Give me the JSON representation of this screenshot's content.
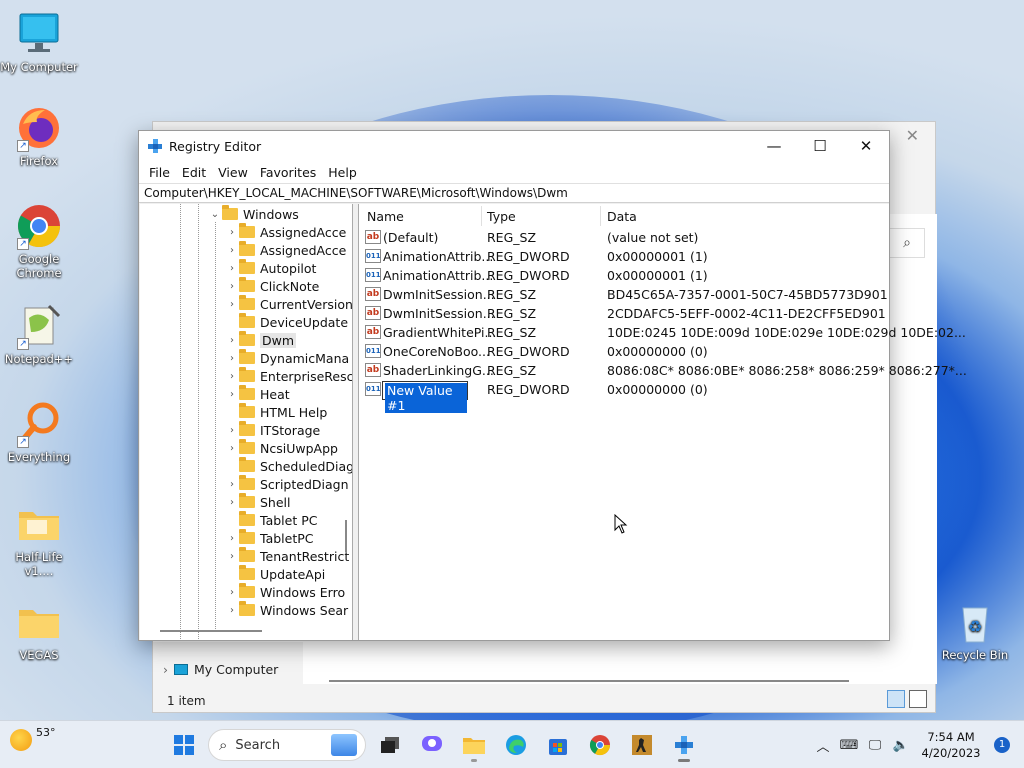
{
  "desktop": {
    "icons": [
      {
        "label": "My Computer"
      },
      {
        "label": "Firefox"
      },
      {
        "label": "Google Chrome"
      },
      {
        "label": "Notepad++"
      },
      {
        "label": "Everything"
      },
      {
        "label": "Half-Life v1...."
      },
      {
        "label": "VEGAS"
      },
      {
        "label": "Recycle Bin"
      }
    ]
  },
  "explorer": {
    "nav_item": "My Computer",
    "status": "1 item"
  },
  "regedit": {
    "title": "Registry Editor",
    "menu": [
      "File",
      "Edit",
      "View",
      "Favorites",
      "Help"
    ],
    "address": "Computer\\HKEY_LOCAL_MACHINE\\SOFTWARE\\Microsoft\\Windows\\Dwm",
    "tree": [
      {
        "label": "Windows",
        "expanded": true
      },
      {
        "label": "AssignedAcce"
      },
      {
        "label": "AssignedAcce"
      },
      {
        "label": "Autopilot"
      },
      {
        "label": "ClickNote"
      },
      {
        "label": "CurrentVersion"
      },
      {
        "label": "DeviceUpdate"
      },
      {
        "label": "Dwm",
        "selected": true
      },
      {
        "label": "DynamicMana"
      },
      {
        "label": "EnterpriseResc"
      },
      {
        "label": "Heat"
      },
      {
        "label": "HTML Help"
      },
      {
        "label": "ITStorage"
      },
      {
        "label": "NcsiUwpApp"
      },
      {
        "label": "ScheduledDiag"
      },
      {
        "label": "ScriptedDiagn"
      },
      {
        "label": "Shell"
      },
      {
        "label": "Tablet PC"
      },
      {
        "label": "TabletPC"
      },
      {
        "label": "TenantRestrict"
      },
      {
        "label": "UpdateApi"
      },
      {
        "label": "Windows Erro"
      },
      {
        "label": "Windows Sear"
      }
    ],
    "columns": {
      "name": "Name",
      "type": "Type",
      "data": "Data"
    },
    "values": [
      {
        "name": "(Default)",
        "type": "REG_SZ",
        "data": "(value not set)",
        "kind": "sz"
      },
      {
        "name": "AnimationAttrib...",
        "type": "REG_DWORD",
        "data": "0x00000001 (1)",
        "kind": "dw"
      },
      {
        "name": "AnimationAttrib...",
        "type": "REG_DWORD",
        "data": "0x00000001 (1)",
        "kind": "dw"
      },
      {
        "name": "DwmInitSession...",
        "type": "REG_SZ",
        "data": "BD45C65A-7357-0001-50C7-45BD5773D901",
        "kind": "sz"
      },
      {
        "name": "DwmInitSession...",
        "type": "REG_SZ",
        "data": "2CDDAFC5-5EFF-0002-4C11-DE2CFF5ED901",
        "kind": "sz"
      },
      {
        "name": "GradientWhitePi...",
        "type": "REG_SZ",
        "data": "10DE:0245 10DE:009d 10DE:029e 10DE:029d 10DE:02...",
        "kind": "sz"
      },
      {
        "name": "OneCoreNoBoo...",
        "type": "REG_DWORD",
        "data": "0x00000000 (0)",
        "kind": "dw"
      },
      {
        "name": "ShaderLinkingG...",
        "type": "REG_SZ",
        "data": "8086:08C* 8086:0BE* 8086:258* 8086:259* 8086:277*...",
        "kind": "sz"
      },
      {
        "name": "New Value #1",
        "type": "REG_DWORD",
        "data": "0x00000000 (0)",
        "kind": "dw",
        "editing": true
      }
    ]
  },
  "taskbar": {
    "weather_temp": "53°",
    "search_placeholder": "Search",
    "time": "7:54 AM",
    "date": "4/20/2023",
    "notification_count": "1"
  },
  "icons_map": {
    "sz": "ab",
    "dw": "011"
  }
}
